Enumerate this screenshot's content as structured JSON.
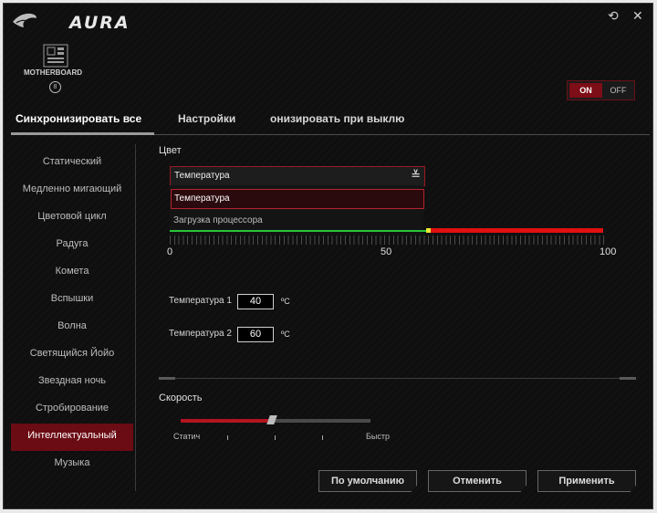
{
  "app": {
    "title": "AURA"
  },
  "window_controls": {
    "refresh_glyph": "⟲",
    "close_glyph": "✕"
  },
  "device": {
    "label": "MOTHERBOARD",
    "index_glyph": "8"
  },
  "power": {
    "on_label": "ON",
    "off_label": "OFF",
    "state": "on"
  },
  "tabs": [
    {
      "label": "Синхронизировать все",
      "active": true
    },
    {
      "label": "Настройки",
      "active": false
    },
    {
      "label": "онизировать при выклю",
      "active": false
    }
  ],
  "sidebar": {
    "items": [
      {
        "label": "Статический"
      },
      {
        "label": "Медленно мигающий"
      },
      {
        "label": "Цветовой цикл"
      },
      {
        "label": "Радуга"
      },
      {
        "label": "Комета"
      },
      {
        "label": "Вспышки"
      },
      {
        "label": "Волна"
      },
      {
        "label": "Светящийся Йойо"
      },
      {
        "label": "Звездная ночь"
      },
      {
        "label": "Стробирование"
      },
      {
        "label": "Интеллектуальный",
        "active": true
      },
      {
        "label": "Музыка"
      }
    ]
  },
  "color_section": {
    "label": "Цвет",
    "select_value": "Температура",
    "options": [
      "Температура",
      "Загрузка процессора"
    ]
  },
  "gauge": {
    "scale_labels": [
      "0",
      "50",
      "100"
    ],
    "threshold": 60,
    "colors": {
      "low": "#28c43a",
      "marker": "#e8e836",
      "high": "#e01010"
    }
  },
  "temperatures": [
    {
      "label": "Температура 1",
      "value": "40",
      "unit": "ºC"
    },
    {
      "label": "Температура 2",
      "value": "60",
      "unit": "ºC"
    }
  ],
  "speed": {
    "label": "Скорость",
    "min_label": "Статич",
    "max_label": "Быстр",
    "level": 0.48
  },
  "buttons": {
    "default": "По умолчанию",
    "cancel": "Отменить",
    "apply": "Применить"
  },
  "colors": {
    "accent": "#9b1a23",
    "active_bg": "#6b0b13",
    "background": "#0f0f10"
  }
}
